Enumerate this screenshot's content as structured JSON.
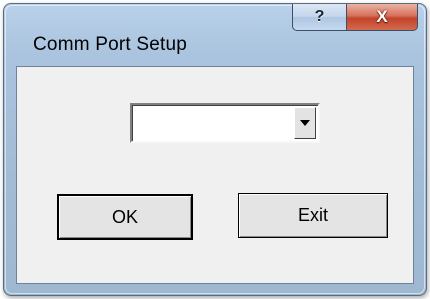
{
  "window": {
    "title": "Comm Port Setup",
    "help_glyph": "?",
    "close_glyph": "X"
  },
  "form": {
    "port_select": {
      "selected_value": "",
      "arrow_icon": "chevron-down-icon"
    },
    "ok_label": "OK",
    "exit_label": "Exit"
  },
  "colors": {
    "frame": "#a9c2dd",
    "close_button": "#c8472d",
    "client_bg": "#f0f0f0"
  }
}
